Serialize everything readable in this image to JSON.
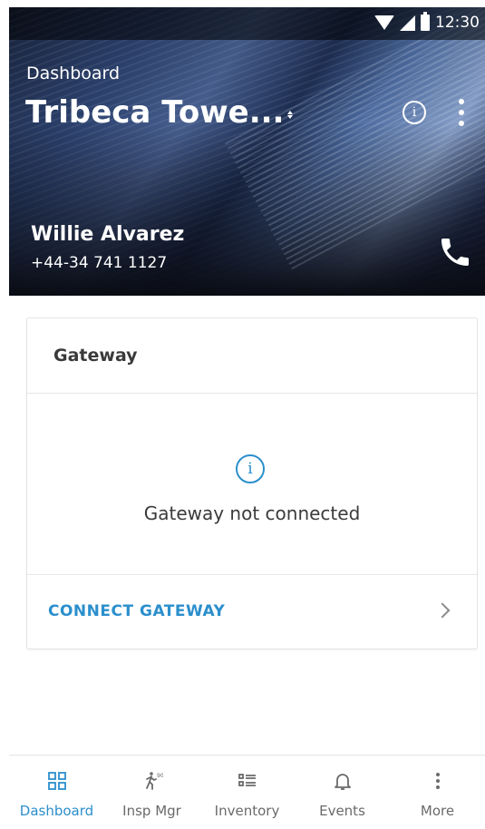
{
  "status_bar": {
    "time": "12:30"
  },
  "header": {
    "breadcrumb": "Dashboard",
    "site_name": "Tribeca Towe...",
    "contact_name": "Willie Alvarez",
    "contact_phone": "+44-34 741 1127",
    "info_icon": "info-icon",
    "menu_icon": "more-vertical-icon",
    "phone_icon": "phone-icon"
  },
  "gateway_card": {
    "title": "Gateway",
    "message": "Gateway not connected",
    "message_icon": "info-icon",
    "action_label": "CONNECT GATEWAY",
    "action_icon": "chevron-right-icon"
  },
  "bottom_nav": {
    "items": [
      {
        "label": "Dashboard",
        "icon": "grid-icon",
        "active": true
      },
      {
        "label": "Insp Mgr",
        "icon": "walking-person-icon",
        "active": false
      },
      {
        "label": "Inventory",
        "icon": "list-icon",
        "active": false
      },
      {
        "label": "Events",
        "icon": "bell-icon",
        "active": false
      },
      {
        "label": "More",
        "icon": "more-vertical-icon",
        "active": false
      }
    ]
  },
  "colors": {
    "accent": "#2b8fcc",
    "nav_inactive": "#6a6a6a",
    "card_title": "#3a3a3a"
  }
}
